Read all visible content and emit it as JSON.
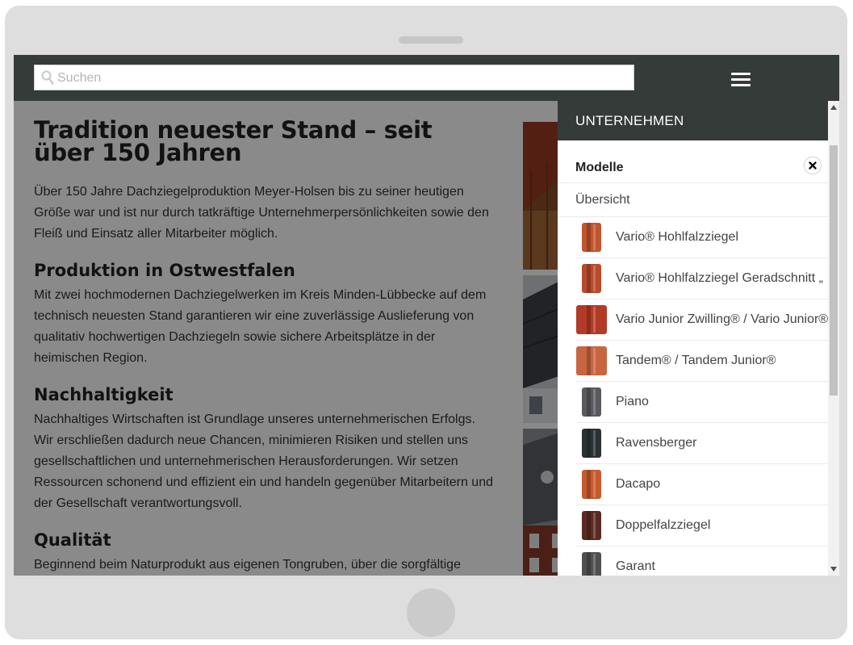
{
  "search": {
    "placeholder": "Suchen"
  },
  "article": {
    "title": "Tradition neuester Stand – seit über 150 Jahren",
    "intro": "Über 150 Jahre Dachziegelproduktion Meyer-Holsen bis zu seiner heutigen Größe war und ist nur durch tatkräftige Unternehmerpersönlichkeiten sowie den Fleiß und Einsatz aller Mitarbeiter möglich.",
    "sections": [
      {
        "heading": "Produktion in Ostwestfalen",
        "text": "Mit zwei hochmodernen Dachziegelwerken im Kreis Minden-Lübbecke auf dem technisch neuesten Stand garantieren wir eine zuverlässige Auslieferung von qualitativ hochwertigen Dachziegeln sowie sichere Arbeitsplätze in der heimischen Region."
      },
      {
        "heading": "Nachhaltigkeit",
        "text": "Nachhaltiges Wirtschaften ist Grundlage unseres unternehmerischen Erfolgs. Wir erschließen dadurch neue Chancen, minimieren Risiken und stellen uns gesellschaftlichen und unternehmerischen Herausforderungen. Wir setzen Ressourcen schonend und effizient ein und handeln gegenüber Mitarbeitern und der Gesellschaft verantwortungsvoll."
      },
      {
        "heading": "Qualität",
        "text": "Beginnend beim Naturprodukt aus eigenen Tongruben, über die sorgfältige"
      }
    ]
  },
  "menu": {
    "header": "UNTERNEHMEN",
    "submenu_title": "Modelle",
    "overview": "Übersicht",
    "products": [
      {
        "name": "Vario® Hohlfalzziegel",
        "color": "#c0552e"
      },
      {
        "name": "Vario® Hohlfalzziegel Geradschnitt „",
        "color": "#b84a2c"
      },
      {
        "name": "Vario Junior Zwilling® / Vario Junior®",
        "color": "#b33a26"
      },
      {
        "name": "Tandem® / Tandem Junior®",
        "color": "#c86540"
      },
      {
        "name": "Piano",
        "color": "#5a5a5e"
      },
      {
        "name": "Ravensberger",
        "color": "#2b3133"
      },
      {
        "name": "Dacapo",
        "color": "#c75a2e"
      },
      {
        "name": "Doppelfalzziegel",
        "color": "#5a2a22"
      },
      {
        "name": "Garant",
        "color": "#4f4f4f"
      }
    ]
  }
}
